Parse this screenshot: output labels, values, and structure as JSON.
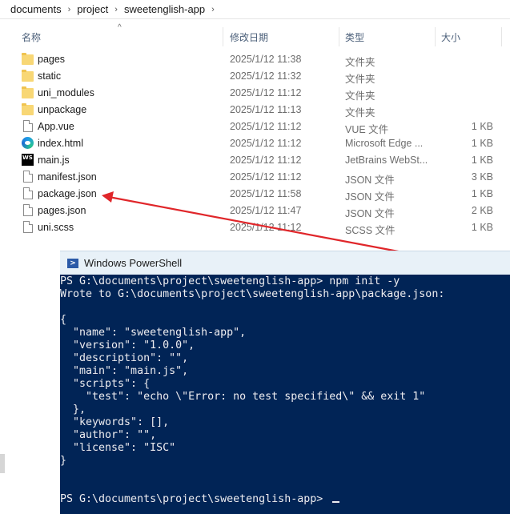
{
  "breadcrumb": [
    "documents",
    "project",
    "sweetenglish-app"
  ],
  "columns": {
    "name": "名称",
    "date": "修改日期",
    "type": "类型",
    "size": "大小"
  },
  "files": [
    {
      "name": "pages",
      "date": "2025/1/12 11:38",
      "type": "文件夹",
      "size": "",
      "icon": "folder-icon"
    },
    {
      "name": "static",
      "date": "2025/1/12 11:32",
      "type": "文件夹",
      "size": "",
      "icon": "folder-icon"
    },
    {
      "name": "uni_modules",
      "date": "2025/1/12 11:12",
      "type": "文件夹",
      "size": "",
      "icon": "folder-icon"
    },
    {
      "name": "unpackage",
      "date": "2025/1/12 11:13",
      "type": "文件夹",
      "size": "",
      "icon": "folder-icon"
    },
    {
      "name": "App.vue",
      "date": "2025/1/12 11:12",
      "type": "VUE 文件",
      "size": "1 KB",
      "icon": "file-icon"
    },
    {
      "name": "index.html",
      "date": "2025/1/12 11:12",
      "type": "Microsoft Edge ...",
      "size": "1 KB",
      "icon": "edge-icon"
    },
    {
      "name": "main.js",
      "date": "2025/1/12 11:12",
      "type": "JetBrains WebSt...",
      "size": "1 KB",
      "icon": "webstorm-icon"
    },
    {
      "name": "manifest.json",
      "date": "2025/1/12 11:12",
      "type": "JSON 文件",
      "size": "3 KB",
      "icon": "file-icon"
    },
    {
      "name": "package.json",
      "date": "2025/1/12 11:58",
      "type": "JSON 文件",
      "size": "1 KB",
      "icon": "file-icon"
    },
    {
      "name": "pages.json",
      "date": "2025/1/12 11:47",
      "type": "JSON 文件",
      "size": "2 KB",
      "icon": "file-icon"
    },
    {
      "name": "uni.scss",
      "date": "2025/1/12 11:12",
      "type": "SCSS 文件",
      "size": "1 KB",
      "icon": "file-icon"
    }
  ],
  "annotation_color": "#e0262a",
  "powershell": {
    "title": "Windows PowerShell",
    "icon_glyph": ">",
    "lines": [
      "PS G:\\documents\\project\\sweetenglish-app> npm init -y",
      "Wrote to G:\\documents\\project\\sweetenglish-app\\package.json:",
      "",
      "{",
      "  \"name\": \"sweetenglish-app\",",
      "  \"version\": \"1.0.0\",",
      "  \"description\": \"\",",
      "  \"main\": \"main.js\",",
      "  \"scripts\": {",
      "    \"test\": \"echo \\\"Error: no test specified\\\" && exit 1\"",
      "  },",
      "  \"keywords\": [],",
      "  \"author\": \"\",",
      "  \"license\": \"ISC\"",
      "}",
      "",
      "",
      "PS G:\\documents\\project\\sweetenglish-app> "
    ]
  }
}
